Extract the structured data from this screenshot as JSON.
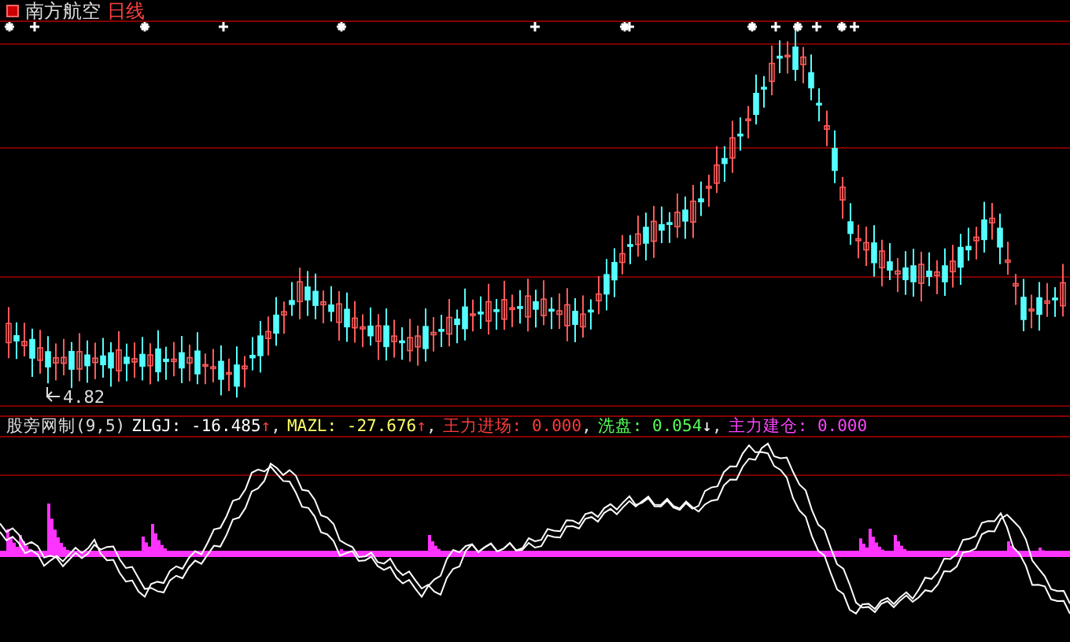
{
  "title": {
    "name": "南方航空",
    "period": "日线"
  },
  "price_chart": {
    "low_label": "4.82"
  },
  "indicator": {
    "name": "股旁网制(9,5)",
    "legend": [
      {
        "text": "ZLGJ: -16.485",
        "arrow": "↑",
        "sep": ",",
        "color": "#ffffff"
      },
      {
        "text": "MAZL: -27.676",
        "arrow": "↑",
        "sep": ",",
        "color": "#ffff66"
      },
      {
        "text": "王力进场: 0.000",
        "sep": ",",
        "color": "#ff3b3b"
      },
      {
        "text": "洗盘: 0.054",
        "arrow": "↓",
        "sep": ",",
        "color": "#55ff55"
      },
      {
        "text": "主力建仓: 0.000",
        "color": "#ff44ff"
      }
    ]
  }
}
